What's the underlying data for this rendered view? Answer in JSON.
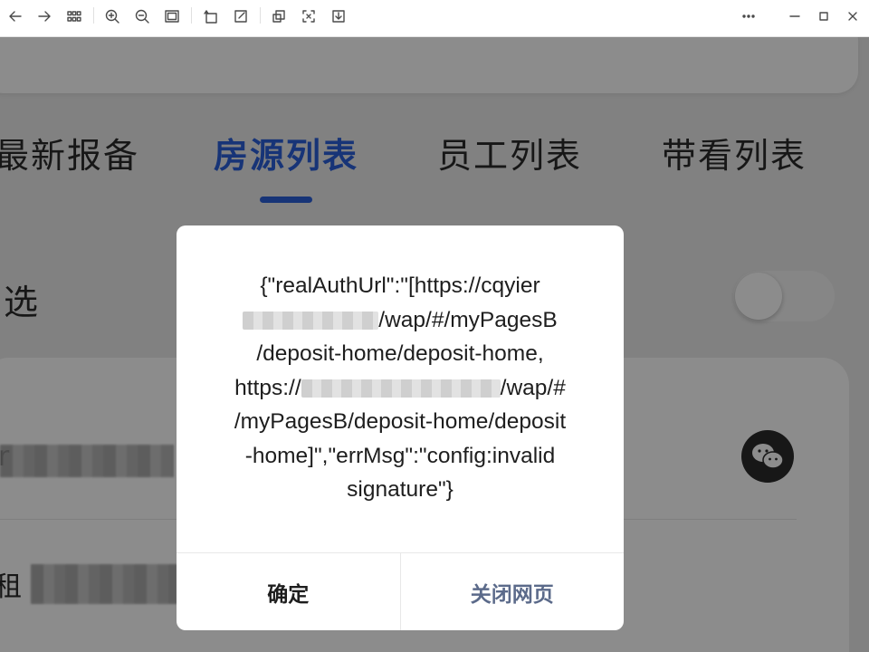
{
  "toolbar": {
    "icons": [
      "arrow-left-icon",
      "arrow-right-icon",
      "grid-icon",
      "zoom-in-icon",
      "zoom-out-icon",
      "fit-window-icon",
      "rotate-icon",
      "edit-icon",
      "copy-icon",
      "crop-icon",
      "download-icon",
      "more-icon",
      "minimize-icon",
      "maximize-icon",
      "close-icon"
    ]
  },
  "tabs": [
    {
      "label": "最新报备",
      "active": false
    },
    {
      "label": "房源列表",
      "active": true
    },
    {
      "label": "员工列表",
      "active": false
    },
    {
      "label": "带看列表",
      "active": false
    }
  ],
  "filter": {
    "label": "选"
  },
  "list": {
    "row1_prefix": "r",
    "row2_prefix": "租"
  },
  "dialog": {
    "line1": "{\"realAuthUrl\":\"[https://cqyier",
    "line2_suffix": "/wap/#/myPagesB",
    "line3": "/deposit-home/deposit-home,",
    "line4_prefix": "https://",
    "line4_suffix": "/wap/#",
    "line5": "/myPagesB/deposit-home/deposit",
    "line6": "-home]\",\"errMsg\":\"config:invalid",
    "line7": "signature\"}",
    "confirm_label": "确定",
    "close_label": "关闭网页"
  },
  "colors": {
    "accent": "#2b5fd9",
    "dialog_secondary": "#5b6a8a"
  }
}
